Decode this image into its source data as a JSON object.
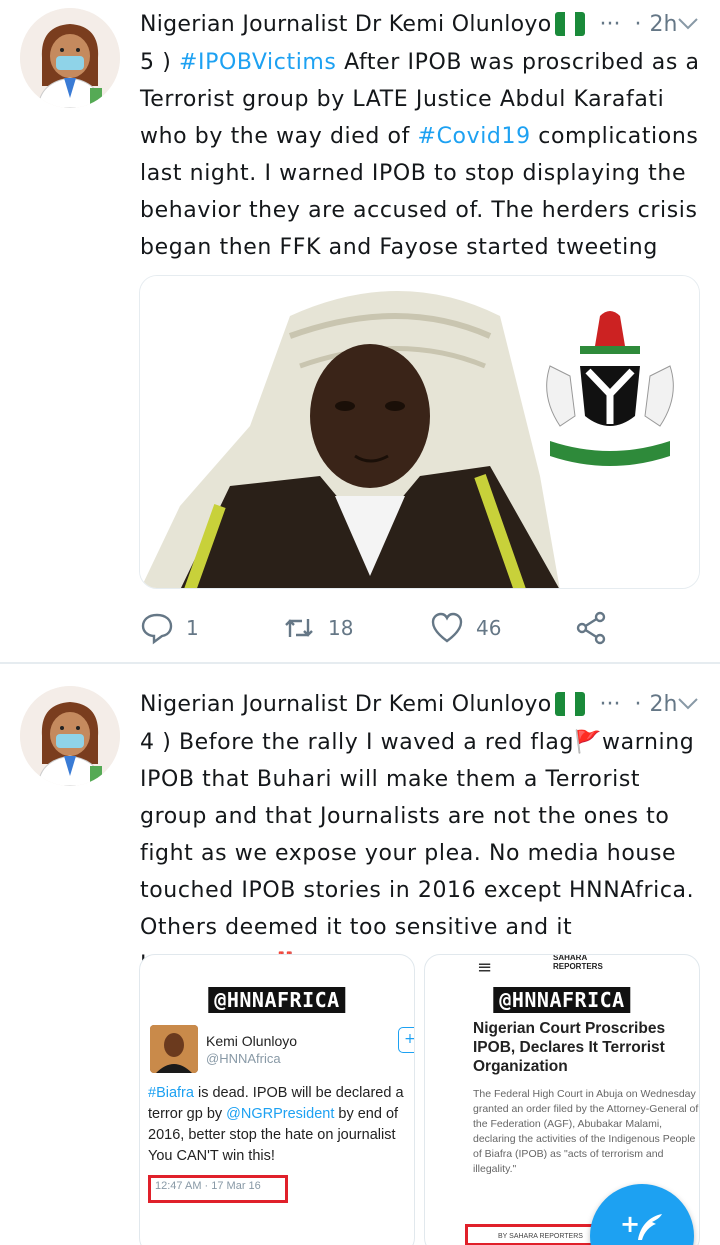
{
  "tweets": [
    {
      "author": "Nigerian Journalist Dr Kemi Olunloyo",
      "more": "···",
      "dot": "·",
      "time": "2h",
      "text_parts": [
        {
          "text": "5 ) ",
          "type": "text"
        },
        {
          "text": "#IPOBVictims",
          "type": "hashtag"
        },
        {
          "text": " After IPOB was proscribed as a Terrorist group by LATE Justice Abdul Karafati who by the way died of ",
          "type": "text"
        },
        {
          "text": "#Covid19",
          "type": "hashtag"
        },
        {
          "text": " complications last night. I warned IPOB to stop displaying the behavior they are accused of. The herders crisis began then FFK and Fayose started tweeting",
          "type": "text"
        }
      ],
      "actions": {
        "replies": "1",
        "retweets": "18",
        "likes": "46"
      }
    },
    {
      "author": "Nigerian Journalist Dr Kemi Olunloyo",
      "more": "···",
      "dot": "·",
      "time": "2h",
      "text": "4 ) Before the rally I waved a red flag🚩warning IPOB that Buhari will make them a Terrorist group and that Journalists are not the ones to fight as we expose your plea. No media house touched IPOB stories in 2016 except HNNAfrica. Others deemed it too sensitive and it HAPPENED ‼️",
      "media": {
        "left": {
          "watermark": "@HNNAFRICA",
          "name": "Kemi Olunloyo",
          "handle": "@HNNAfrica",
          "follow": "+",
          "lines": [
            {
              "parts": [
                {
                  "t": "#Biafra",
                  "l": true
                },
                {
                  "t": " is dead. IPOB will be declared a",
                  "l": false
                }
              ]
            },
            {
              "parts": [
                {
                  "t": "terror gp by ",
                  "l": false
                },
                {
                  "t": "@NGRPresident",
                  "l": true
                },
                {
                  "t": " by end of",
                  "l": false
                }
              ]
            },
            {
              "parts": [
                {
                  "t": "2016, better stop the hate on journalist",
                  "l": false
                }
              ]
            },
            {
              "parts": [
                {
                  "t": "You CAN'T win this!",
                  "l": false
                }
              ]
            }
          ],
          "date": "12:47 AM · 17 Mar 16"
        },
        "right": {
          "menu": "≡",
          "logo_line1": "SAHARA",
          "logo_line2": "REPORTERS",
          "watermark": "@HNNAFRICA",
          "headline": "Nigerian Court Proscribes IPOB, Declares It Terrorist Organization",
          "body": "The Federal High Court in Abuja on Wednesday granted an order filed by the Attorney-General of the Federation (AGF), Abubakar Malami, declaring the activities of the Indigenous People of Biafra (IPOB) as \"acts of terrorism and illegality.\"",
          "byline": "BY SAHARA REPORTERS"
        }
      }
    }
  ],
  "fab": {
    "label": "+"
  },
  "colors": {
    "link": "#1da1f2",
    "muted": "#657786",
    "highlight_box": "#e0202a"
  }
}
